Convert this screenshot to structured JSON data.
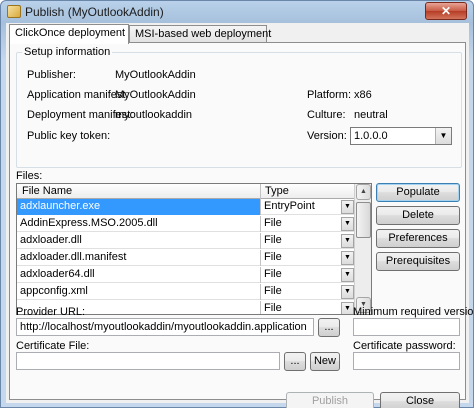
{
  "window": {
    "title": "Publish (MyOutlookAddin)",
    "close_glyph": "✕"
  },
  "tabs": [
    {
      "label": "ClickOnce deployment"
    },
    {
      "label": "MSI-based web deployment"
    }
  ],
  "setup": {
    "legend": "Setup information",
    "publisher_label": "Publisher:",
    "publisher_value": "MyOutlookAddin",
    "app_manifest_label": "Application manifest:",
    "app_manifest_value": "MyOutlookAddin",
    "deploy_manifest_label": "Deployment manifest:",
    "deploy_manifest_value": "myoutlookaddin",
    "public_key_label": "Public key token:",
    "platform_label": "Platform:",
    "platform_value": "x86",
    "culture_label": "Culture:",
    "culture_value": "neutral",
    "version_label": "Version:",
    "version_value": "1.0.0.0"
  },
  "files": {
    "label": "Files:",
    "columns": [
      "File Name",
      "Type"
    ],
    "rows": [
      {
        "name": "adxlauncher.exe",
        "type": "EntryPoint"
      },
      {
        "name": "AddinExpress.MSO.2005.dll",
        "type": "File"
      },
      {
        "name": "adxloader.dll",
        "type": "File"
      },
      {
        "name": "adxloader.dll.manifest",
        "type": "File"
      },
      {
        "name": "adxloader64.dll",
        "type": "File"
      },
      {
        "name": "appconfig.xml",
        "type": "File"
      },
      {
        "name": "",
        "type": "File"
      }
    ]
  },
  "side_buttons": {
    "populate": "Populate",
    "delete": "Delete",
    "preferences": "Preferences",
    "prerequisites": "Prerequisites"
  },
  "provider": {
    "label": "Provider URL:",
    "value": "http://localhost/myoutlookaddin/myoutlookaddin.application",
    "browse": "..."
  },
  "min_version": {
    "label": "Minimum required version:",
    "value": ""
  },
  "certificate": {
    "label": "Certificate File:",
    "value": "",
    "browse": "...",
    "new": "New"
  },
  "cert_password": {
    "label": "Certificate password:",
    "value": ""
  },
  "footer": {
    "publish": "Publish",
    "close": "Close"
  }
}
